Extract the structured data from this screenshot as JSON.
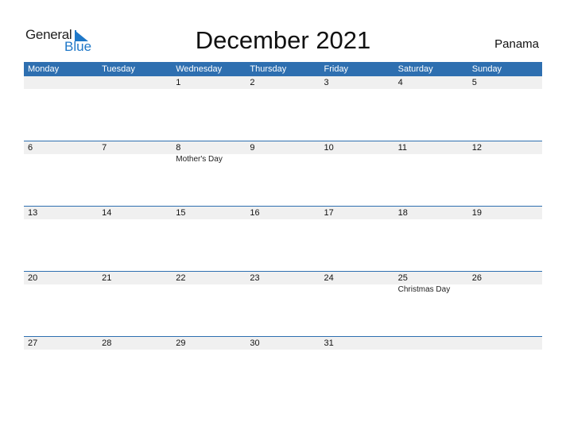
{
  "logo": {
    "line1": "General",
    "line2": "Blue"
  },
  "title": "December 2021",
  "country": "Panama",
  "colors": {
    "header_bg": "#2e6fb0",
    "strip_bg": "#f0f0f0",
    "logo_blue": "#1f78c8"
  },
  "weekdays": [
    "Monday",
    "Tuesday",
    "Wednesday",
    "Thursday",
    "Friday",
    "Saturday",
    "Sunday"
  ],
  "weeks": [
    {
      "days": [
        "",
        "",
        "1",
        "2",
        "3",
        "4",
        "5"
      ],
      "events": [
        "",
        "",
        "",
        "",
        "",
        "",
        ""
      ]
    },
    {
      "days": [
        "6",
        "7",
        "8",
        "9",
        "10",
        "11",
        "12"
      ],
      "events": [
        "",
        "",
        "Mother's Day",
        "",
        "",
        "",
        ""
      ]
    },
    {
      "days": [
        "13",
        "14",
        "15",
        "16",
        "17",
        "18",
        "19"
      ],
      "events": [
        "",
        "",
        "",
        "",
        "",
        "",
        ""
      ]
    },
    {
      "days": [
        "20",
        "21",
        "22",
        "23",
        "24",
        "25",
        "26"
      ],
      "events": [
        "",
        "",
        "",
        "",
        "",
        "Christmas Day",
        ""
      ]
    },
    {
      "days": [
        "27",
        "28",
        "29",
        "30",
        "31",
        "",
        ""
      ],
      "events": [
        "",
        "",
        "",
        "",
        "",
        "",
        ""
      ]
    }
  ]
}
